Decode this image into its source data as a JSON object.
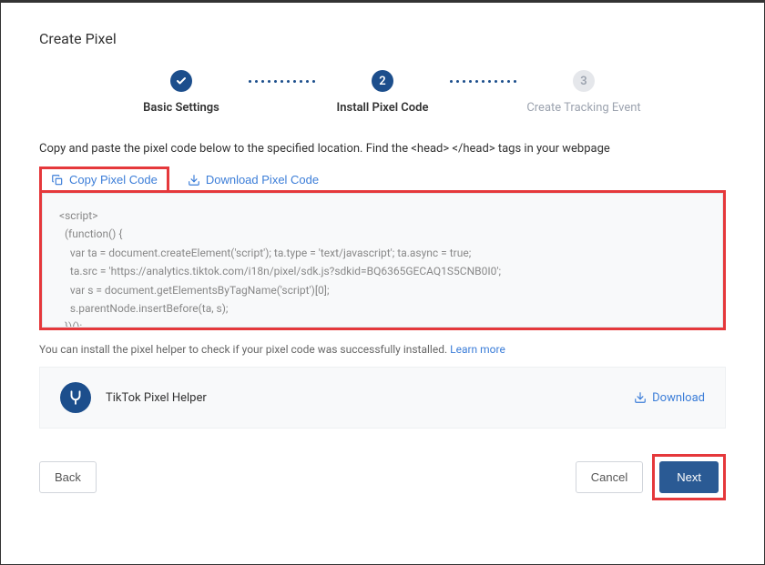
{
  "title": "Create Pixel",
  "stepper": {
    "steps": [
      {
        "label": "Basic Settings",
        "state": "done"
      },
      {
        "label": "Install Pixel Code",
        "state": "active",
        "num": "2"
      },
      {
        "label": "Create Tracking Event",
        "state": "pending",
        "num": "3"
      }
    ]
  },
  "instruction": "Copy and paste the pixel code below to the specified location. Find the <head> </head> tags in your webpage",
  "actions": {
    "copy_label": "Copy Pixel Code",
    "download_label": "Download Pixel Code"
  },
  "code": "<script>\n  (function() {\n    var ta = document.createElement('script'); ta.type = 'text/javascript'; ta.async = true;\n    ta.src = 'https://analytics.tiktok.com/i18n/pixel/sdk.js?sdkid=BQ6365GECAQ1S5CNB0I0';\n    var s = document.getElementsByTagName('script')[0];\n    s.parentNode.insertBefore(ta, s);\n  })();",
  "helper_text": {
    "prefix": "You can install the pixel helper to check if your pixel code was successfully installed.",
    "learn_more": "Learn more"
  },
  "helper_box": {
    "name": "TikTok Pixel Helper",
    "download": "Download"
  },
  "footer": {
    "back": "Back",
    "cancel": "Cancel",
    "next": "Next"
  }
}
